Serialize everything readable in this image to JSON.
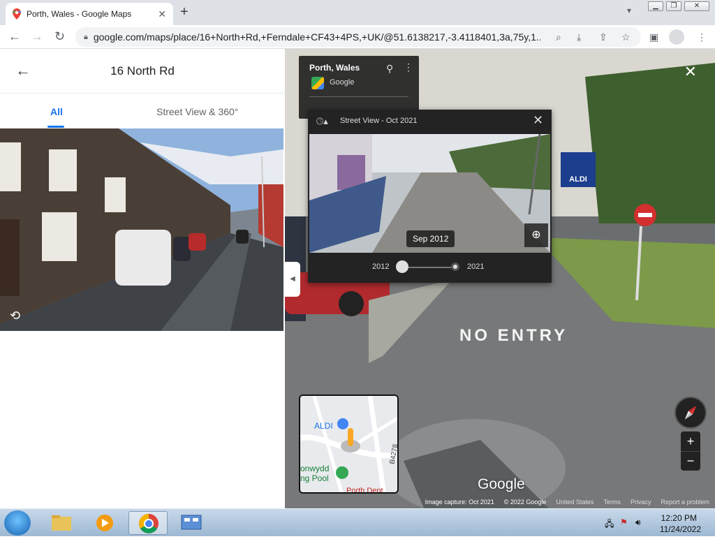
{
  "browser": {
    "tab_title": "Porth, Wales - Google Maps",
    "tab_close": "✕",
    "new_tab": "+",
    "url": "google.com/maps/place/16+North+Rd,+Ferndale+CF43+4PS,+UK/@51.6138217,-3.4118401,3a,75y,1..."
  },
  "left_panel": {
    "title": "16 North Rd",
    "tabs": [
      {
        "label": "All"
      },
      {
        "label": "Street View & 360°"
      }
    ]
  },
  "info_card": {
    "title": "Porth, Wales",
    "source": "Google"
  },
  "time_machine": {
    "title": "Street View - Oct 2021",
    "date_label": "Sep 2012",
    "year_start": "2012",
    "year_end": "2021",
    "selected_position": 0.0
  },
  "minimap": {
    "place_label": "ALDI",
    "road_label": "B4278",
    "pool_line1": "onwydd",
    "pool_line2": "ng Pool",
    "bottom_label": "Porth Dent"
  },
  "scene": {
    "road_marking": "NO ENTRY",
    "store_sign": "ALDI"
  },
  "street_view": {
    "logo": "Google",
    "footer": {
      "capture": "Image capture: Oct 2021",
      "copyright": "© 2022 Google",
      "region": "United States",
      "terms": "Terms",
      "privacy": "Privacy",
      "report": "Report a problem"
    }
  },
  "taskbar": {
    "time": "12:20 PM",
    "date": "11/24/2022"
  },
  "colors": {
    "accent_blue": "#1a73e8",
    "panel_dark": "#232323"
  }
}
